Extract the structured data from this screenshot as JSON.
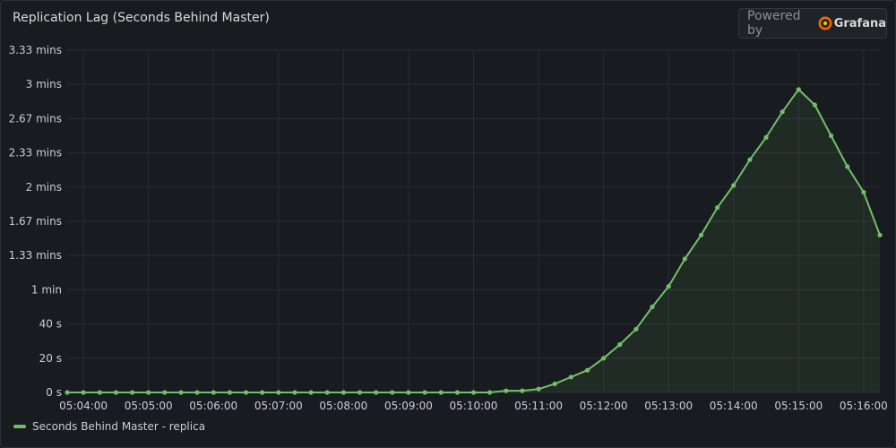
{
  "panel": {
    "title": "Replication Lag (Seconds Behind Master)"
  },
  "branding": {
    "powered_by": "Powered by",
    "brand_name": "Grafana",
    "logo_icon": "grafana-logo-icon",
    "logo_color": "#f46800"
  },
  "colors": {
    "series": "#73bf69",
    "grid": "#2a2d33",
    "axis_text": "#ccccdc"
  },
  "legend": {
    "entries": [
      "Seconds Behind Master - replica"
    ]
  },
  "chart_data": {
    "type": "area",
    "title": "Replication Lag (Seconds Behind Master)",
    "xlabel": "",
    "ylabel": "",
    "x_ticks": [
      "05:04:00",
      "05:05:00",
      "05:06:00",
      "05:07:00",
      "05:08:00",
      "05:09:00",
      "05:10:00",
      "05:11:00",
      "05:12:00",
      "05:13:00",
      "05:14:00",
      "05:15:00",
      "05:16:00"
    ],
    "y_ticks": [
      {
        "value": 0,
        "label": "0 s"
      },
      {
        "value": 20,
        "label": "20 s"
      },
      {
        "value": 40,
        "label": "40 s"
      },
      {
        "value": 60,
        "label": "1 min"
      },
      {
        "value": 80,
        "label": "1.33 mins"
      },
      {
        "value": 100,
        "label": "1.67 mins"
      },
      {
        "value": 120,
        "label": "2 mins"
      },
      {
        "value": 140,
        "label": "2.33 mins"
      },
      {
        "value": 160,
        "label": "2.67 mins"
      },
      {
        "value": 180,
        "label": "3 mins"
      },
      {
        "value": 200,
        "label": "3.33 mins"
      }
    ],
    "xlim": [
      "05:03:45",
      "05:16:15"
    ],
    "ylim": [
      0,
      200
    ],
    "grid": true,
    "legend_position": "bottom-left",
    "series": [
      {
        "name": "Seconds Behind Master - replica",
        "color": "#73bf69",
        "x": [
          "05:03:45",
          "05:04:00",
          "05:04:15",
          "05:04:30",
          "05:04:45",
          "05:05:00",
          "05:05:15",
          "05:05:30",
          "05:05:45",
          "05:06:00",
          "05:06:15",
          "05:06:30",
          "05:06:45",
          "05:07:00",
          "05:07:15",
          "05:07:30",
          "05:07:45",
          "05:08:00",
          "05:08:15",
          "05:08:30",
          "05:08:45",
          "05:09:00",
          "05:09:15",
          "05:09:30",
          "05:09:45",
          "05:10:00",
          "05:10:15",
          "05:10:30",
          "05:10:45",
          "05:11:00",
          "05:11:15",
          "05:11:30",
          "05:11:45",
          "05:12:00",
          "05:12:15",
          "05:12:30",
          "05:12:45",
          "05:13:00",
          "05:13:15",
          "05:13:30",
          "05:13:45",
          "05:14:00",
          "05:14:15",
          "05:14:30",
          "05:14:45",
          "05:15:00",
          "05:15:15",
          "05:15:30",
          "05:15:45",
          "05:16:00",
          "05:16:15"
        ],
        "values": [
          0,
          0,
          0,
          0,
          0,
          0,
          0,
          0,
          0,
          0,
          0,
          0,
          0,
          0,
          0,
          0,
          0,
          0,
          0,
          0,
          0,
          0,
          0,
          0,
          0,
          0,
          0,
          1,
          1,
          2,
          5,
          9,
          13,
          20,
          28,
          37,
          50,
          62,
          78,
          92,
          108,
          121,
          136,
          149,
          164,
          177,
          168,
          150,
          132,
          117,
          92
        ]
      }
    ]
  }
}
